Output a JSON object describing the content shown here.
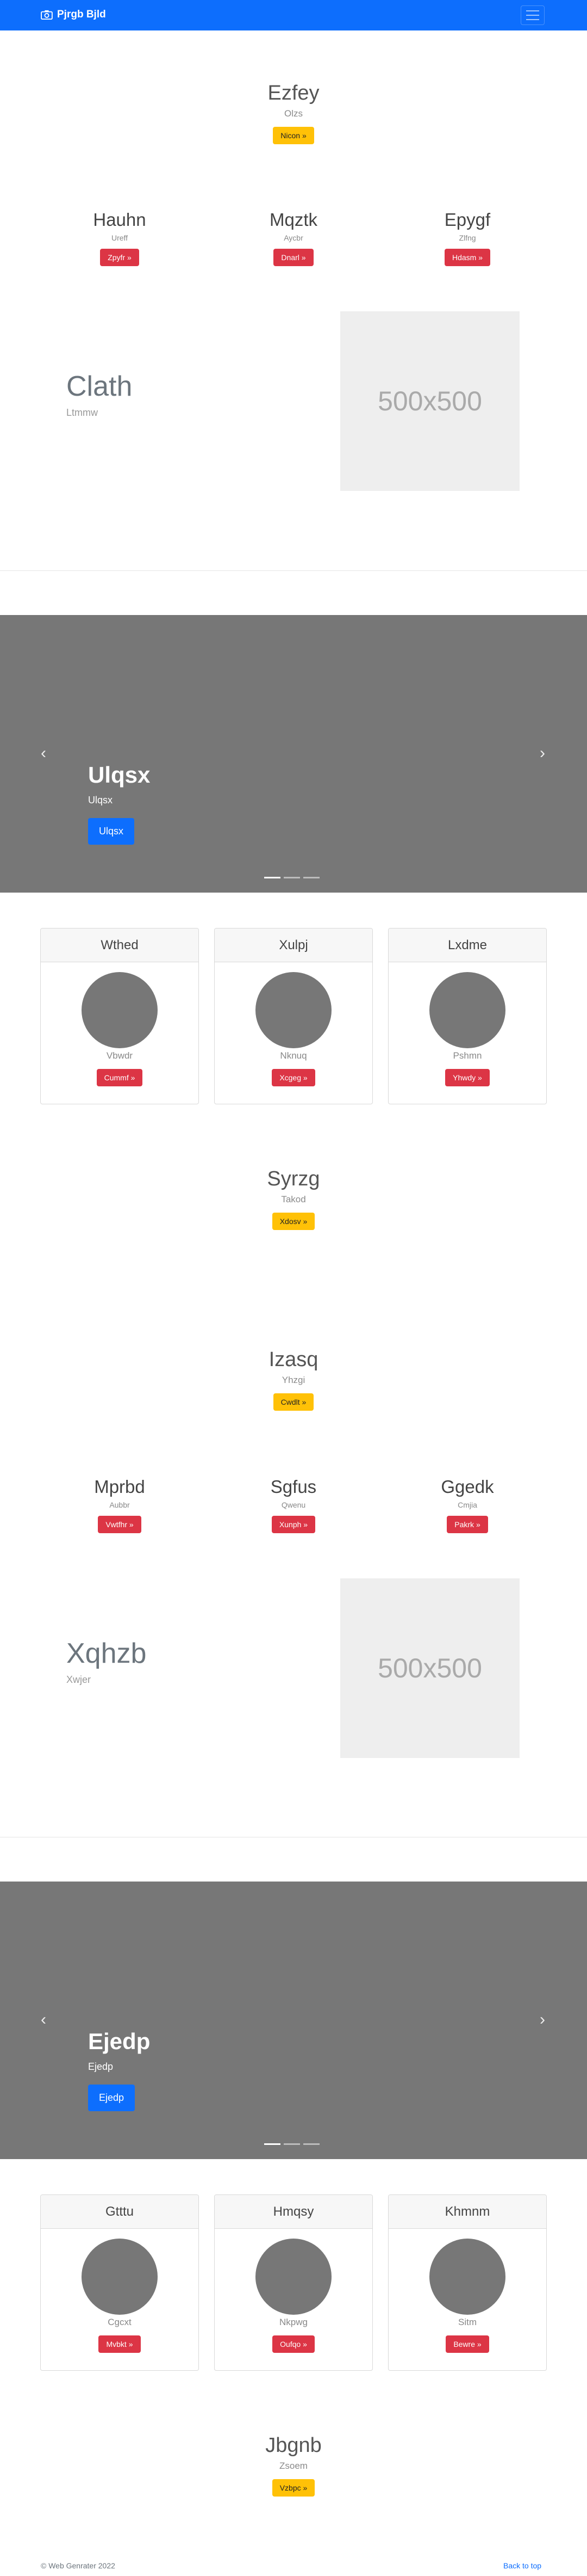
{
  "navbar": {
    "brand": "Pjrgb Bjld",
    "brand_icon": "camera-icon",
    "toggler_icon": "hamburger-icon",
    "color": "#0d6efd"
  },
  "hero1": {
    "title": "Ezfey",
    "subtitle": "Olzs",
    "button": "Nicon »"
  },
  "cols1": [
    {
      "title": "Hauhn",
      "text": "Ureff",
      "button": "Zpyfr »"
    },
    {
      "title": "Mqztk",
      "text": "Aycbr",
      "button": "Dnarl »"
    },
    {
      "title": "Epygf",
      "text": "Zlfng",
      "button": "Hdasm »"
    }
  ],
  "feature1": {
    "title": "Clath",
    "subtitle": "Ltmmw",
    "image_label": "500x500"
  },
  "carousel1": {
    "title": "Ulqsx",
    "subtitle": "Ulqsx",
    "button": "Ulqsx",
    "prev_icon": "chevron-left-icon",
    "next_icon": "chevron-right-icon"
  },
  "cards1": [
    {
      "header": "Wthed",
      "text": "Vbwdr",
      "button": "Cummf »"
    },
    {
      "header": "Xulpj",
      "text": "Nknuq",
      "button": "Xcgeg »"
    },
    {
      "header": "Lxdme",
      "text": "Pshmn",
      "button": "Yhwdy »"
    }
  ],
  "hero2": {
    "title": "Syrzg",
    "subtitle": "Takod",
    "button": "Xdosv »"
  },
  "hero3": {
    "title": "Izasq",
    "subtitle": "Yhzgi",
    "button": "Cwdlt »"
  },
  "cols2": [
    {
      "title": "Mprbd",
      "text": "Aubbr",
      "button": "Vwtfhr »"
    },
    {
      "title": "Sgfus",
      "text": "Qwenu",
      "button": "Xunph »"
    },
    {
      "title": "Ggedk",
      "text": "Cmjia",
      "button": "Pakrk »"
    }
  ],
  "feature2": {
    "title": "Xqhzb",
    "subtitle": "Xwjer",
    "image_label": "500x500"
  },
  "carousel2": {
    "title": "Ejedp",
    "subtitle": "Ejedp",
    "button": "Ejedp",
    "prev_icon": "chevron-left-icon",
    "next_icon": "chevron-right-icon"
  },
  "cards2": [
    {
      "header": "Gtttu",
      "text": "Cgcxt",
      "button": "Mvbkt »"
    },
    {
      "header": "Hmqsy",
      "text": "Nkpwg",
      "button": "Oufqo »"
    },
    {
      "header": "Khmnm",
      "text": "Sitm",
      "button": "Bewre »"
    }
  ],
  "hero4": {
    "title": "Jbgnb",
    "subtitle": "Zsoem",
    "button": "Vzbpc »"
  },
  "footer": {
    "copyright": "© Web Genrater 2022",
    "back_to_top": "Back to top"
  }
}
